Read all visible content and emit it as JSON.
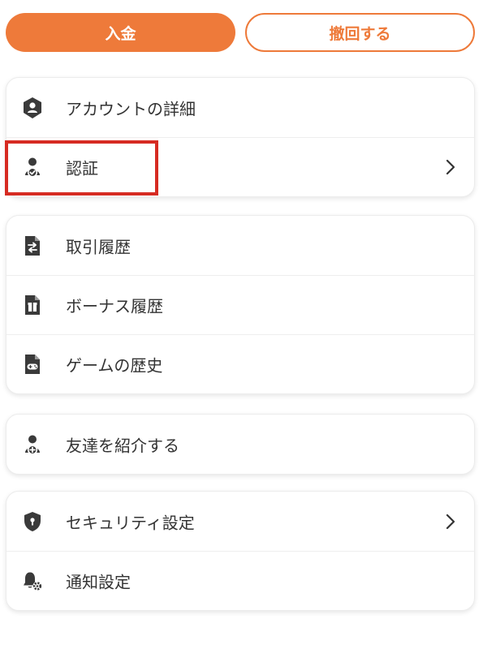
{
  "actions": {
    "deposit_label": "入金",
    "withdraw_label": "撤回する"
  },
  "menu": {
    "account": [
      {
        "label": "アカウントの詳細",
        "icon": "account-shield-icon"
      },
      {
        "label": "認証",
        "icon": "verified-user-icon",
        "chevron": true,
        "highlighted": true
      }
    ],
    "history": [
      {
        "label": "取引履歴",
        "icon": "transaction-doc-icon"
      },
      {
        "label": "ボーナス履歴",
        "icon": "bonus-doc-icon"
      },
      {
        "label": "ゲームの歴史",
        "icon": "game-doc-icon"
      }
    ],
    "referral": [
      {
        "label": "友達を紹介する",
        "icon": "add-user-icon"
      }
    ],
    "settings": [
      {
        "label": "セキュリティ設定",
        "icon": "security-shield-icon",
        "chevron": true
      },
      {
        "label": "通知設定",
        "icon": "bell-settings-icon"
      }
    ]
  },
  "colors": {
    "accent": "#ee7a3a",
    "highlight": "#d62b22",
    "icon": "#3a3a3a"
  }
}
